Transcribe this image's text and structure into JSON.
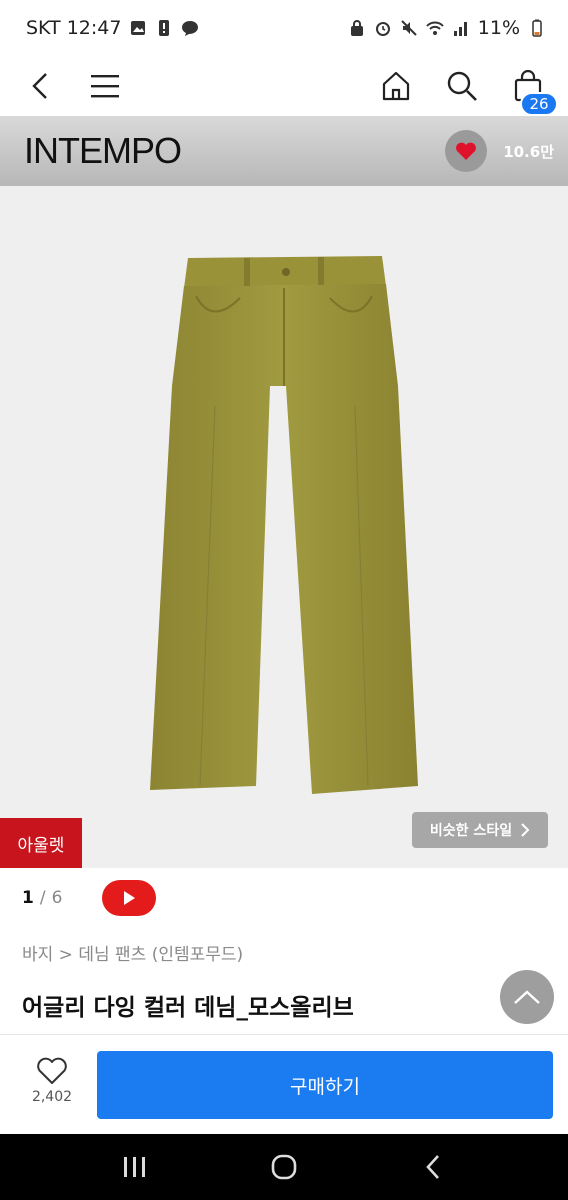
{
  "status_bar": {
    "carrier_time": "SKT 12:47",
    "battery": "11%"
  },
  "topbar": {
    "cart_count": "26"
  },
  "brand": {
    "name": "INTEMPO",
    "likes": "10.6만"
  },
  "image": {
    "outlet_tag": "아울렛",
    "similar_style": "비슷한 스타일",
    "pants_color": "#9a9138"
  },
  "pager": {
    "current": "1",
    "separator": "/",
    "total": "6"
  },
  "breadcrumb": {
    "text": "바지 > 데님 팬츠 (인템포무드)"
  },
  "product": {
    "title": "어글리 다잉 컬러 데님_모스올리브"
  },
  "actions": {
    "like_count": "2,402",
    "buy_label": "구매하기"
  },
  "colors": {
    "accent_blue": "#1a7cf0",
    "outlet_red": "#c8141c",
    "youtube_red": "#e31b1b"
  }
}
